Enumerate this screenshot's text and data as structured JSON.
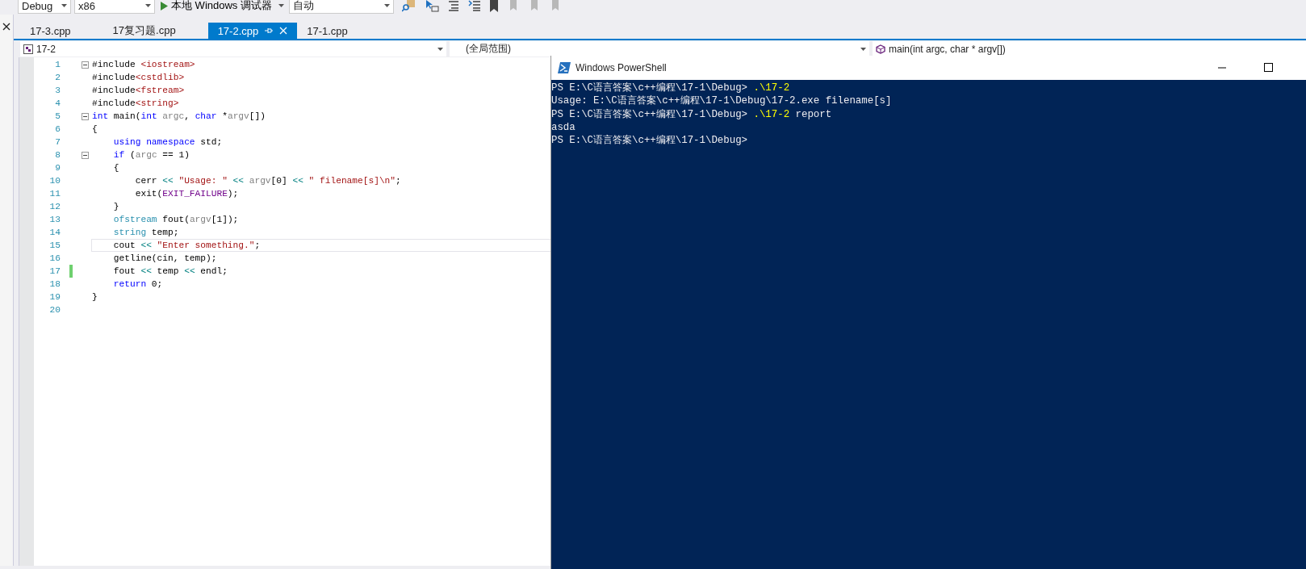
{
  "toolbar": {
    "configuration": "Debug",
    "platform": "x86",
    "run_button": "本地 Windows 调试器",
    "mode": "自动"
  },
  "tabs": [
    {
      "label": "17-3.cpp",
      "selected": false
    },
    {
      "label": "17复习题.cpp",
      "selected": false
    },
    {
      "label": "17-2.cpp",
      "selected": true
    },
    {
      "label": "17-1.cpp",
      "selected": false
    }
  ],
  "nav_bar": {
    "project": "17-2",
    "scope": "(全局范围)",
    "member": "main(int argc, char * argv[])"
  },
  "editor": {
    "lines": [
      {
        "number": "1",
        "collapsible": true,
        "changed": false,
        "current": false,
        "tokens": [
          {
            "kind": "plain",
            "text": "#include "
          },
          {
            "kind": "str",
            "text": "<iostream>"
          }
        ]
      },
      {
        "number": "2",
        "collapsible": false,
        "changed": false,
        "current": false,
        "tokens": [
          {
            "kind": "plain",
            "text": "#include"
          },
          {
            "kind": "str",
            "text": "<cstdlib>"
          }
        ]
      },
      {
        "number": "3",
        "collapsible": false,
        "changed": false,
        "current": false,
        "tokens": [
          {
            "kind": "plain",
            "text": "#include"
          },
          {
            "kind": "str",
            "text": "<fstream>"
          }
        ]
      },
      {
        "number": "4",
        "collapsible": false,
        "changed": false,
        "current": false,
        "tokens": [
          {
            "kind": "plain",
            "text": "#include"
          },
          {
            "kind": "str",
            "text": "<string>"
          }
        ]
      },
      {
        "number": "5",
        "collapsible": true,
        "changed": false,
        "current": false,
        "tokens": [
          {
            "kind": "kw",
            "text": "int"
          },
          {
            "kind": "plain",
            "text": " main("
          },
          {
            "kind": "kw",
            "text": "int"
          },
          {
            "kind": "param",
            "text": " argc"
          },
          {
            "kind": "plain",
            "text": ", "
          },
          {
            "kind": "kw",
            "text": "char"
          },
          {
            "kind": "plain",
            "text": " *"
          },
          {
            "kind": "param",
            "text": "argv"
          },
          {
            "kind": "plain",
            "text": "[])"
          }
        ]
      },
      {
        "number": "6",
        "collapsible": false,
        "changed": false,
        "current": false,
        "tokens": [
          {
            "kind": "plain",
            "text": "{"
          }
        ]
      },
      {
        "number": "7",
        "collapsible": false,
        "changed": false,
        "current": false,
        "tokens": [
          {
            "kind": "kw",
            "text": "    using namespace"
          },
          {
            "kind": "plain",
            "text": " std;"
          }
        ]
      },
      {
        "number": "8",
        "collapsible": true,
        "changed": false,
        "current": false,
        "tokens": [
          {
            "kind": "kw",
            "text": "    if"
          },
          {
            "kind": "plain",
            "text": " ("
          },
          {
            "kind": "param",
            "text": "argc"
          },
          {
            "kind": "plain",
            "text": " == 1)"
          }
        ]
      },
      {
        "number": "9",
        "collapsible": false,
        "changed": false,
        "current": false,
        "tokens": [
          {
            "kind": "plain",
            "text": "    {"
          }
        ]
      },
      {
        "number": "10",
        "collapsible": false,
        "changed": false,
        "current": false,
        "tokens": [
          {
            "kind": "plain",
            "text": "        cerr "
          },
          {
            "kind": "op",
            "text": "<<"
          },
          {
            "kind": "str",
            "text": " \"Usage: \" "
          },
          {
            "kind": "op",
            "text": "<<"
          },
          {
            "kind": "param",
            "text": " argv"
          },
          {
            "kind": "plain",
            "text": "[0] "
          },
          {
            "kind": "op",
            "text": "<<"
          },
          {
            "kind": "str",
            "text": " \" filename[s]\\n\""
          },
          {
            "kind": "plain",
            "text": ";"
          }
        ]
      },
      {
        "number": "11",
        "collapsible": false,
        "changed": false,
        "current": false,
        "tokens": [
          {
            "kind": "plain",
            "text": "        exit("
          },
          {
            "kind": "macro",
            "text": "EXIT_FAILURE"
          },
          {
            "kind": "plain",
            "text": ");"
          }
        ]
      },
      {
        "number": "12",
        "collapsible": false,
        "changed": false,
        "current": false,
        "tokens": [
          {
            "kind": "plain",
            "text": "    }"
          }
        ]
      },
      {
        "number": "13",
        "collapsible": false,
        "changed": false,
        "current": false,
        "tokens": [
          {
            "kind": "type",
            "text": "    ofstream"
          },
          {
            "kind": "plain",
            "text": " fout("
          },
          {
            "kind": "param",
            "text": "argv"
          },
          {
            "kind": "plain",
            "text": "[1]);"
          }
        ]
      },
      {
        "number": "14",
        "collapsible": false,
        "changed": false,
        "current": false,
        "tokens": [
          {
            "kind": "type",
            "text": "    string"
          },
          {
            "kind": "plain",
            "text": " temp;"
          }
        ]
      },
      {
        "number": "15",
        "collapsible": false,
        "changed": false,
        "current": true,
        "tokens": [
          {
            "kind": "plain",
            "text": "    cout "
          },
          {
            "kind": "op",
            "text": "<<"
          },
          {
            "kind": "str",
            "text": " \"Enter something.\""
          },
          {
            "kind": "plain",
            "text": ";"
          }
        ]
      },
      {
        "number": "16",
        "collapsible": false,
        "changed": false,
        "current": false,
        "tokens": [
          {
            "kind": "plain",
            "text": "    getline(cin, temp);"
          }
        ]
      },
      {
        "number": "17",
        "collapsible": false,
        "changed": true,
        "current": false,
        "tokens": [
          {
            "kind": "plain",
            "text": "    fout "
          },
          {
            "kind": "op",
            "text": "<<"
          },
          {
            "kind": "plain",
            "text": " temp "
          },
          {
            "kind": "op",
            "text": "<<"
          },
          {
            "kind": "plain",
            "text": " endl;"
          }
        ]
      },
      {
        "number": "18",
        "collapsible": false,
        "changed": false,
        "current": false,
        "tokens": [
          {
            "kind": "kw",
            "text": "    return"
          },
          {
            "kind": "plain",
            "text": " 0;"
          }
        ]
      },
      {
        "number": "19",
        "collapsible": false,
        "changed": false,
        "current": false,
        "tokens": [
          {
            "kind": "plain",
            "text": "}"
          }
        ]
      },
      {
        "number": "20",
        "collapsible": false,
        "changed": false,
        "current": false
      }
    ]
  },
  "powershell": {
    "title": "Windows PowerShell",
    "lines": [
      [
        {
          "kind": "prompt",
          "text": "PS E:\\C语言答案\\c++编程\\17-1\\Debug> "
        },
        {
          "kind": "command",
          "text": ".\\17-2"
        }
      ],
      [
        {
          "kind": "output",
          "text": "Usage: E:\\C语言答案\\c++编程\\17-1\\Debug\\17-2.exe filename[s]"
        }
      ],
      [
        {
          "kind": "prompt",
          "text": "PS E:\\C语言答案\\c++编程\\17-1\\Debug> "
        },
        {
          "kind": "command",
          "text": ".\\17-2"
        },
        {
          "kind": "output",
          "text": " report"
        }
      ],
      [
        {
          "kind": "output",
          "text": "asda"
        }
      ],
      [
        {
          "kind": "prompt",
          "text": "PS E:\\C语言答案\\c++编程\\17-1\\Debug>"
        }
      ]
    ]
  }
}
